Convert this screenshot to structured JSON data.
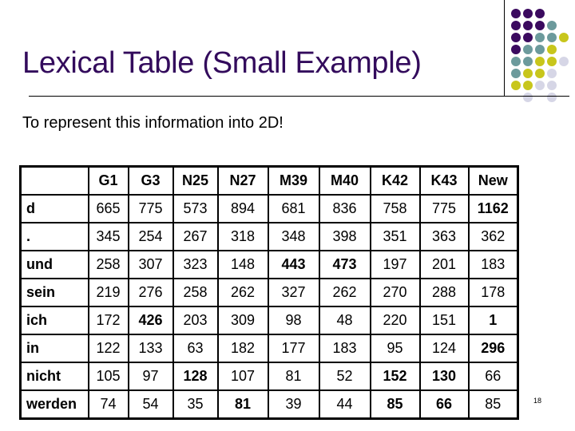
{
  "slide": {
    "title": "Lexical Table (Small Example)",
    "subtitle": "To represent this information into 2D!",
    "page_number": "18",
    "colors": {
      "title": "#330b5c",
      "dot_purple": "#3b0a5f",
      "dot_teal": "#6c9a9c",
      "dot_yellow": "#c8c61c",
      "dot_lavender": "#d6d6e6"
    }
  },
  "decoration": {
    "dot_grid": [
      [
        "purple",
        "purple",
        "purple",
        "",
        "",
        ""
      ],
      [
        "purple",
        "purple",
        "purple",
        "teal",
        "",
        ""
      ],
      [
        "purple",
        "purple",
        "teal",
        "teal",
        "yellow",
        ""
      ],
      [
        "purple",
        "teal",
        "teal",
        "yellow",
        "",
        ""
      ],
      [
        "teal",
        "teal",
        "yellow",
        "yellow",
        "lavender",
        ""
      ],
      [
        "teal",
        "yellow",
        "yellow",
        "lavender",
        "",
        ""
      ],
      [
        "yellow",
        "yellow",
        "lavender",
        "lavender",
        "",
        ""
      ],
      [
        "",
        "lavender",
        "",
        "lavender",
        "",
        ""
      ]
    ]
  },
  "table": {
    "corner": "",
    "columns": [
      "G1",
      "G3",
      "N25",
      "N27",
      "M39",
      "M40",
      "K42",
      "K43",
      "New"
    ],
    "rows": [
      {
        "label": "d",
        "values": [
          "665",
          "775",
          "573",
          "894",
          "681",
          "836",
          "758",
          "775",
          "1162"
        ],
        "bold": [
          false,
          false,
          false,
          false,
          false,
          false,
          false,
          false,
          true
        ]
      },
      {
        "label": ".",
        "values": [
          "345",
          "254",
          "267",
          "318",
          "348",
          "398",
          "351",
          "363",
          "362"
        ],
        "bold": [
          false,
          false,
          false,
          false,
          false,
          false,
          false,
          false,
          false
        ]
      },
      {
        "label": "und",
        "values": [
          "258",
          "307",
          "323",
          "148",
          "443",
          "473",
          "197",
          "201",
          "183"
        ],
        "bold": [
          false,
          false,
          false,
          false,
          true,
          true,
          false,
          false,
          false
        ]
      },
      {
        "label": "sein",
        "values": [
          "219",
          "276",
          "258",
          "262",
          "327",
          "262",
          "270",
          "288",
          "178"
        ],
        "bold": [
          false,
          false,
          false,
          false,
          false,
          false,
          false,
          false,
          false
        ]
      },
      {
        "label": "ich",
        "values": [
          "172",
          "426",
          "203",
          "309",
          "98",
          "48",
          "220",
          "151",
          "1"
        ],
        "bold": [
          false,
          true,
          false,
          false,
          false,
          false,
          false,
          false,
          true
        ]
      },
      {
        "label": "in",
        "values": [
          "122",
          "133",
          "63",
          "182",
          "177",
          "183",
          "95",
          "124",
          "296"
        ],
        "bold": [
          false,
          false,
          false,
          false,
          false,
          false,
          false,
          false,
          true
        ]
      },
      {
        "label": "nicht",
        "values": [
          "105",
          "97",
          "128",
          "107",
          "81",
          "52",
          "152",
          "130",
          "66"
        ],
        "bold": [
          false,
          false,
          true,
          false,
          false,
          false,
          true,
          true,
          false
        ]
      },
      {
        "label": "werden",
        "values": [
          "74",
          "54",
          "35",
          "81",
          "39",
          "44",
          "85",
          "66",
          "85"
        ],
        "bold": [
          false,
          false,
          false,
          true,
          false,
          false,
          true,
          true,
          false
        ]
      }
    ]
  }
}
